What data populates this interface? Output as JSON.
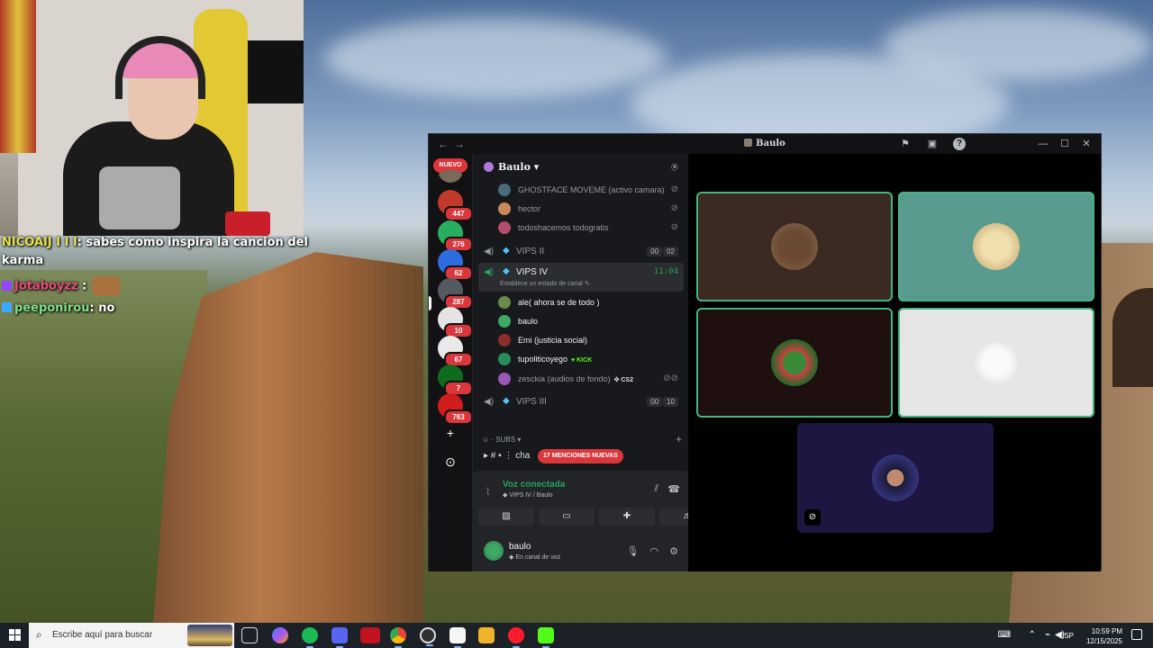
{
  "stream_chat": [
    {
      "user": "NICOAIJ I I I",
      "message": ": sabes como inspira la cancion del"
    },
    {
      "user": "",
      "message": "karma"
    },
    {
      "user": "Jotaboyzz",
      "message": ":"
    },
    {
      "user": "peeponirou",
      "message": ": no"
    }
  ],
  "discord": {
    "window_title": "Baulo",
    "server_rail": {
      "nuevo_label": "NUEVO",
      "servers": [
        {
          "count": "447",
          "color": "#c0392b"
        },
        {
          "count": "276",
          "color": "#27ae60"
        },
        {
          "count": "62",
          "color": "#2d6cdf"
        },
        {
          "count": "287",
          "color": "#555a61"
        },
        {
          "count": "10",
          "color": "#e4e4e4"
        },
        {
          "count": "67",
          "color": "#e9e9e9"
        },
        {
          "count": "7",
          "color": "#0f6b1e"
        },
        {
          "count": "763",
          "color": "#d01c1c"
        }
      ],
      "add_server": "+",
      "explore": "⊙"
    },
    "server_name": "Baulo",
    "members_top": [
      {
        "name": "GHOSTFACE MOVEME (activo camara)",
        "color": "#4a6b7a"
      },
      {
        "name": "hector",
        "color": "#c98a5a"
      },
      {
        "name": "todoshacemos todogratis",
        "color": "#b34d6b"
      }
    ],
    "channels": {
      "vips2": {
        "name": "VIPS II",
        "count_a": "00",
        "count_b": "02"
      },
      "vips4": {
        "name": "VIPS IV",
        "timer": "11:04",
        "status": "Establece un estado de canal"
      },
      "vips3": {
        "name": "VIPS III",
        "count_a": "00",
        "count_b": "10"
      }
    },
    "members_vips4": [
      {
        "name": "ale( ahora se de todo )",
        "color": "#6a8a4a",
        "active": true
      },
      {
        "name": "baulo",
        "color": "#3ea864",
        "active": true
      },
      {
        "name": "Emi (justicia social)",
        "color": "#8b2d2d",
        "active": true
      },
      {
        "name": "tupoliticoyego",
        "color": "#2a8c5a",
        "active": true,
        "tag": "KICK"
      },
      {
        "name": "zesckia (audios de fondo)",
        "color": "#9b59b6",
        "active": false,
        "tag": "CS2"
      }
    ],
    "category": "SUBS",
    "text_channel": "cha",
    "mentions_badge": "17 MENCIONES NUEVAS",
    "voice_panel": {
      "title": "Voz conectada",
      "subtitle": "VIPS IV / Baulo"
    },
    "user_panel": {
      "name": "baulo",
      "status": "En canal de voz"
    },
    "video_tiles": [
      {
        "bg": "#3b2a21",
        "face": "#7a5a3a",
        "speaking": true
      },
      {
        "bg": "#5a9b90",
        "face": "#e6d2a0",
        "speaking": true
      },
      {
        "bg": "#1f0f0f",
        "face": "#d04040",
        "speaking": true
      },
      {
        "bg": "#e6e6e6",
        "face": "#f5f5f5",
        "speaking": true
      },
      {
        "bg": "#1d1640",
        "face": "#2a2a6a",
        "speaking": false
      }
    ]
  },
  "taskbar": {
    "search_placeholder": "Escribe aquí para buscar",
    "language": "ESP",
    "time": "10:59 PM",
    "date": "12/15/2025"
  }
}
